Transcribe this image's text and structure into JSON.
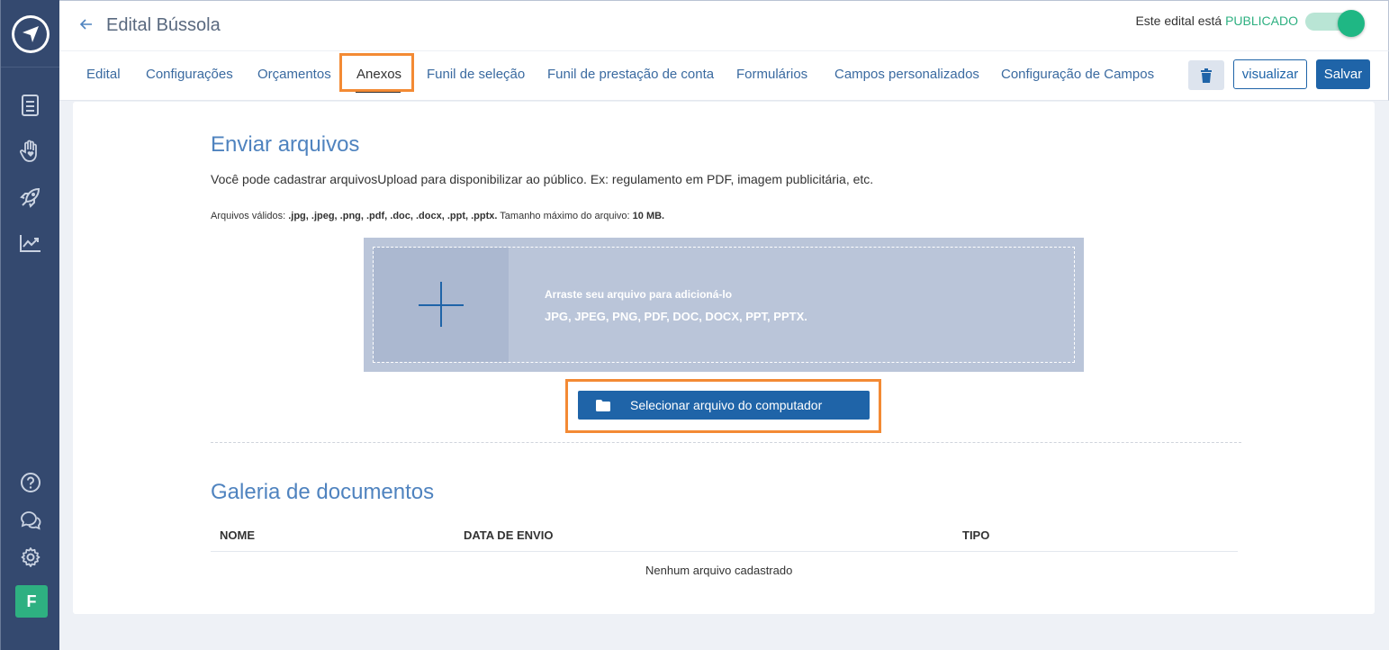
{
  "header": {
    "title": "Edital Bússola",
    "status_prefix": "Este edital está",
    "status_value": "PUBLICADO",
    "status_color": "#2eb081"
  },
  "sidebar": {
    "icons": [
      "document-icon",
      "hand-heart-icon",
      "rocket-icon",
      "chart-icon",
      "help-icon",
      "chat-icon",
      "gear-icon"
    ],
    "avatar_letter": "F"
  },
  "tabs": [
    {
      "label": "Edital"
    },
    {
      "label": "Configurações"
    },
    {
      "label": "Orçamentos"
    },
    {
      "label": "Anexos",
      "active": true
    },
    {
      "label": "Funil de seleção"
    },
    {
      "label": "Funil de prestação de conta"
    },
    {
      "label": "Formulários"
    },
    {
      "label": "Campos personalizados"
    },
    {
      "label": "Configuração de Campos"
    }
  ],
  "toolbar": {
    "visualizar_label": "visualizar",
    "salvar_label": "Salvar"
  },
  "upload": {
    "title": "Enviar arquivos",
    "intro": "Você pode cadastrar arquivosUpload para disponibilizar ao público. Ex: regulamento em PDF, imagem publicitária, etc.",
    "valid_prefix": "Arquivos válidos: ",
    "valid_types": ".jpg, .jpeg, .png, .pdf, .doc, .docx, .ppt, .pptx.",
    "max_size_prefix": " Tamanho máximo do arquivo: ",
    "max_size": "10 MB.",
    "drop_hint": "Arraste seu arquivo para adicioná-lo",
    "drop_types": "JPG, JPEG, PNG, PDF, DOC, DOCX, PPT, PPTX.",
    "select_button": "Selecionar arquivo do computador"
  },
  "gallery": {
    "title": "Galeria de documentos",
    "columns": [
      "NOME",
      "DATA DE ENVIO",
      "TIPO"
    ],
    "empty_message": "Nenhum arquivo cadastrado"
  },
  "colors": {
    "accent": "#1f64a8",
    "sidebar": "#34496f",
    "highlight": "#f38a34"
  }
}
